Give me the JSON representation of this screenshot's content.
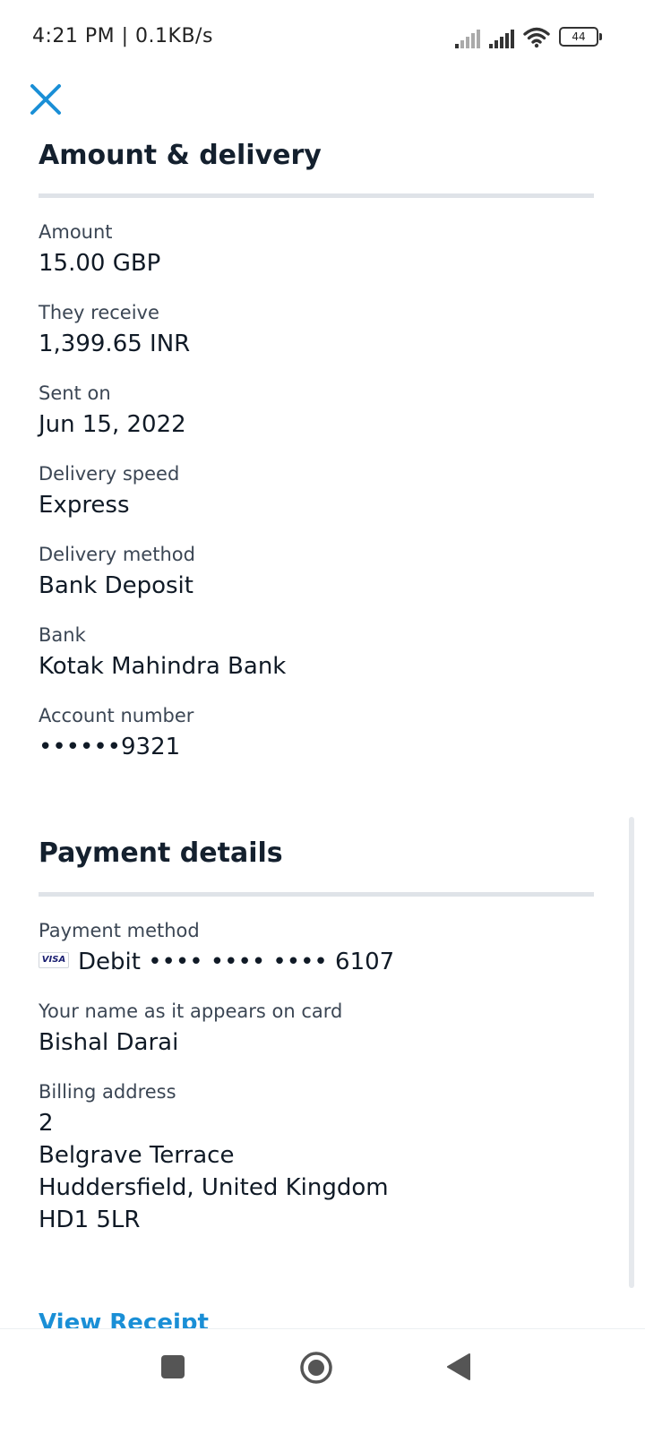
{
  "status_bar": {
    "time": "4:21 PM | 0.1KB/s",
    "battery": "44",
    "icons": [
      "signal-weak-icon",
      "signal-icon",
      "wifi-icon",
      "battery-icon"
    ]
  },
  "header": {
    "close_icon": "close-icon",
    "accent_color": "#1a8fd6"
  },
  "amount_section": {
    "title": "Amount & delivery",
    "fields": [
      {
        "label": "Amount",
        "value": "15.00 GBP"
      },
      {
        "label": "They receive",
        "value": "1,399.65 INR"
      },
      {
        "label": "Sent on",
        "value": "Jun 15, 2022"
      },
      {
        "label": "Delivery speed",
        "value": "Express"
      },
      {
        "label": "Delivery method",
        "value": "Bank Deposit"
      },
      {
        "label": "Bank",
        "value": "Kotak Mahindra Bank"
      },
      {
        "label": "Account number",
        "value": "••••••9321"
      }
    ]
  },
  "payment_section": {
    "title": "Payment details",
    "fields": [
      {
        "label": "Payment method",
        "card_brand": "VISA",
        "value": "Debit •••• •••• •••• 6107"
      },
      {
        "label": "Your name as it appears on card",
        "value": "Bishal Darai"
      },
      {
        "label": "Billing address",
        "lines": [
          "2",
          "Belgrave Terrace",
          "Huddersfield, United Kingdom",
          "HD1 5LR"
        ]
      }
    ]
  },
  "actions": {
    "view_receipt": "View Receipt"
  },
  "nav_bar": {
    "icons": [
      "recents-square-icon",
      "home-circle-icon",
      "back-triangle-icon"
    ]
  }
}
